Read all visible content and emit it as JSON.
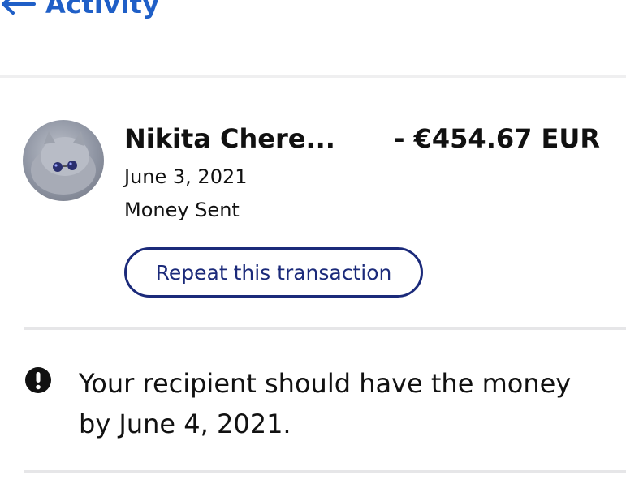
{
  "header": {
    "back_label": "Activity"
  },
  "transaction": {
    "name": "Nikita Chere...",
    "amount": "- €454.67 EUR",
    "date": "June 3, 2021",
    "type": "Money Sent",
    "repeat_label": "Repeat this transaction"
  },
  "notice": {
    "text": "Your recipient should have the money by June 4, 2021."
  },
  "colors": {
    "link_blue": "#1f5fc7",
    "button_navy": "#1b2a7a"
  },
  "icons": {
    "back": "arrow-left-icon",
    "notice": "exclamation-circle-icon"
  }
}
